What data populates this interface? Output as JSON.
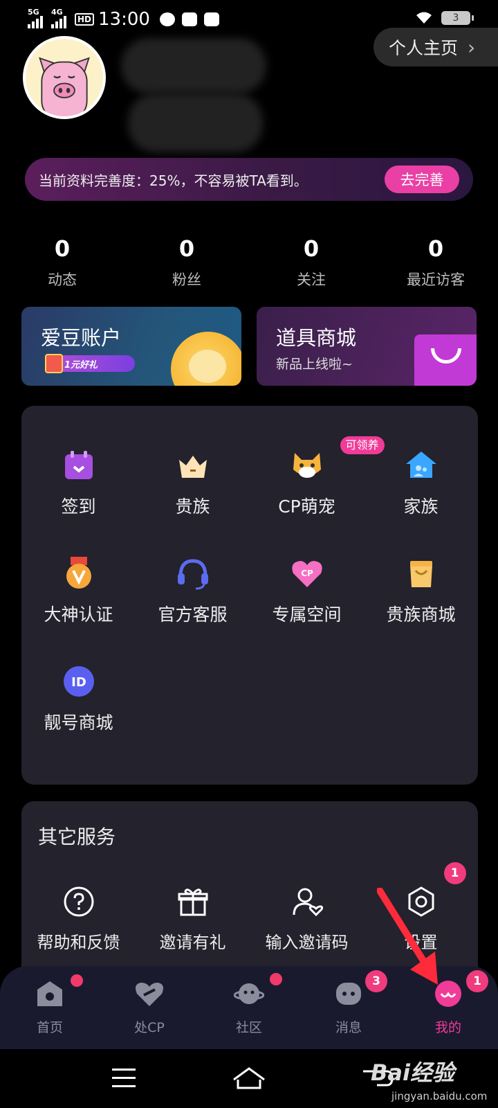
{
  "status_bar": {
    "network_1": "5G",
    "network_2": "4G",
    "hd": "HD",
    "time": "13:00",
    "battery": "3"
  },
  "header": {
    "profile_button": "个人主页",
    "completion_text": "当前资料完善度：25%，不容易被TA看到。",
    "completion_button": "去完善"
  },
  "stats": [
    {
      "value": "0",
      "label": "动态"
    },
    {
      "value": "0",
      "label": "粉丝"
    },
    {
      "value": "0",
      "label": "关注"
    },
    {
      "value": "0",
      "label": "最近访客"
    }
  ],
  "cards": {
    "account": {
      "title": "爱豆账户",
      "badge": "1元好礼"
    },
    "shop": {
      "title": "道具商城",
      "subtitle": "新品上线啦~"
    }
  },
  "grid": [
    {
      "label": "签到",
      "icon": "calendar-check-icon"
    },
    {
      "label": "贵族",
      "icon": "crown-icon"
    },
    {
      "label": "CP萌宠",
      "icon": "cat-icon",
      "badge": "可领养"
    },
    {
      "label": "家族",
      "icon": "family-house-icon"
    },
    {
      "label": "大神认证",
      "icon": "medal-icon"
    },
    {
      "label": "官方客服",
      "icon": "headset-icon"
    },
    {
      "label": "专属空间",
      "icon": "cp-heart-icon"
    },
    {
      "label": "贵族商城",
      "icon": "shopping-bag-icon"
    },
    {
      "label": "靓号商城",
      "icon": "id-icon"
    }
  ],
  "other_services": {
    "title": "其它服务",
    "items": [
      {
        "label": "帮助和反馈",
        "icon": "help-icon"
      },
      {
        "label": "邀请有礼",
        "icon": "gift-icon"
      },
      {
        "label": "输入邀请码",
        "icon": "invite-user-icon"
      },
      {
        "label": "设置",
        "icon": "settings-icon",
        "count": "1"
      }
    ]
  },
  "tabbar": [
    {
      "label": "首页",
      "icon": "home-icon",
      "dot": true
    },
    {
      "label": "处CP",
      "icon": "heart-tab-icon"
    },
    {
      "label": "社区",
      "icon": "planet-icon",
      "dot": true
    },
    {
      "label": "消息",
      "icon": "message-icon",
      "count": "3"
    },
    {
      "label": "我的",
      "icon": "me-icon",
      "count": "1",
      "active": true
    }
  ],
  "watermark": {
    "brand": "Bai经验",
    "url": "jingyan.baidu.com"
  },
  "colors": {
    "accent": "#f03b97",
    "panel": "#23222d",
    "badge_red": "#f03b7d"
  }
}
